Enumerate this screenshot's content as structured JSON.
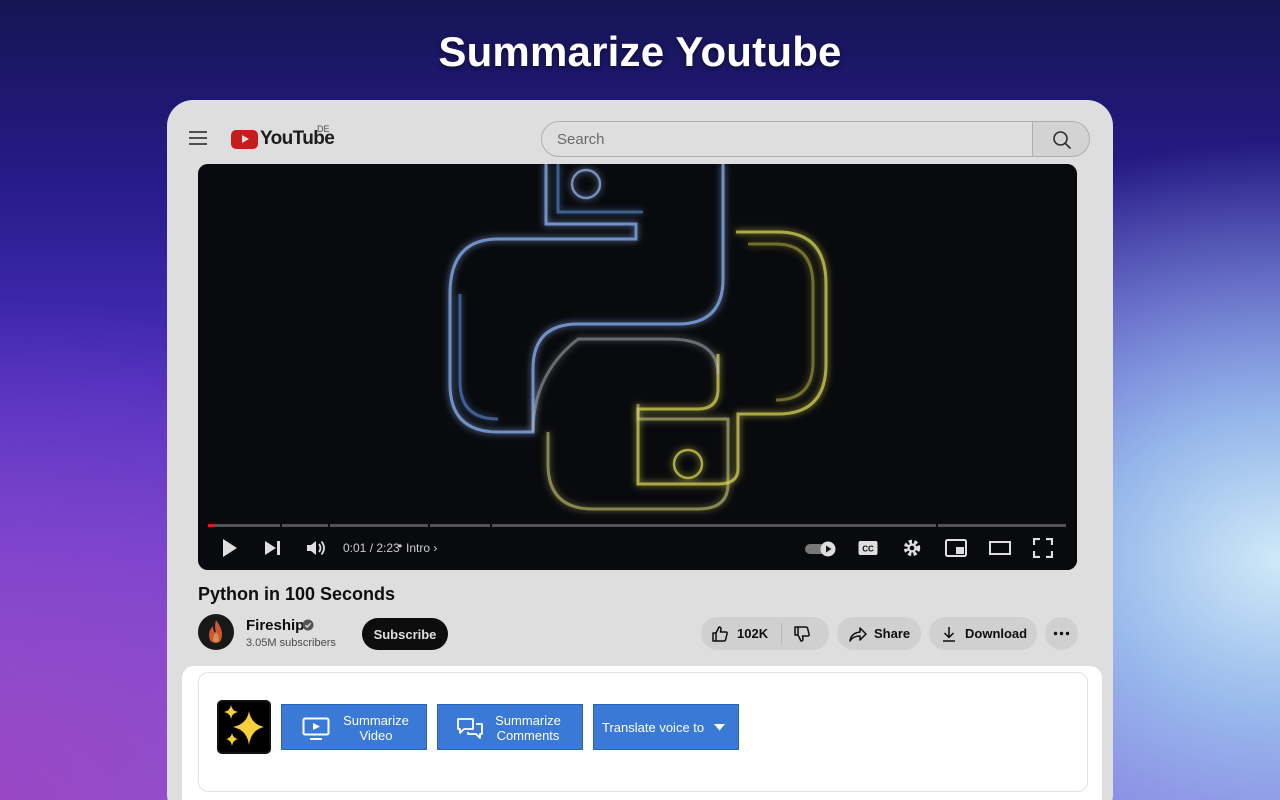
{
  "headline": "Summarize Youtube",
  "header": {
    "logo_text": "YouTube",
    "region": "DE",
    "search_placeholder": "Search"
  },
  "player": {
    "time": "0:01 / 2:23",
    "chapter": "Intro",
    "progress_fraction": 0.007
  },
  "video": {
    "title": "Python in 100 Seconds",
    "channel": "Fireship",
    "subscribers": "3.05M subscribers",
    "subscribe_label": "Subscribe",
    "likes": "102K",
    "share_label": "Share",
    "download_label": "Download"
  },
  "extension": {
    "summarize_video_line1": "Summarize",
    "summarize_video_line2": "Video",
    "summarize_comments_line1": "Summarize",
    "summarize_comments_line2": "Comments",
    "translate_label": "Translate voice to"
  },
  "colors": {
    "extension_button": "#3b79d6",
    "youtube_red": "#e32222",
    "python_blue": "#6aa6ff",
    "python_yellow": "#e6e35a"
  }
}
